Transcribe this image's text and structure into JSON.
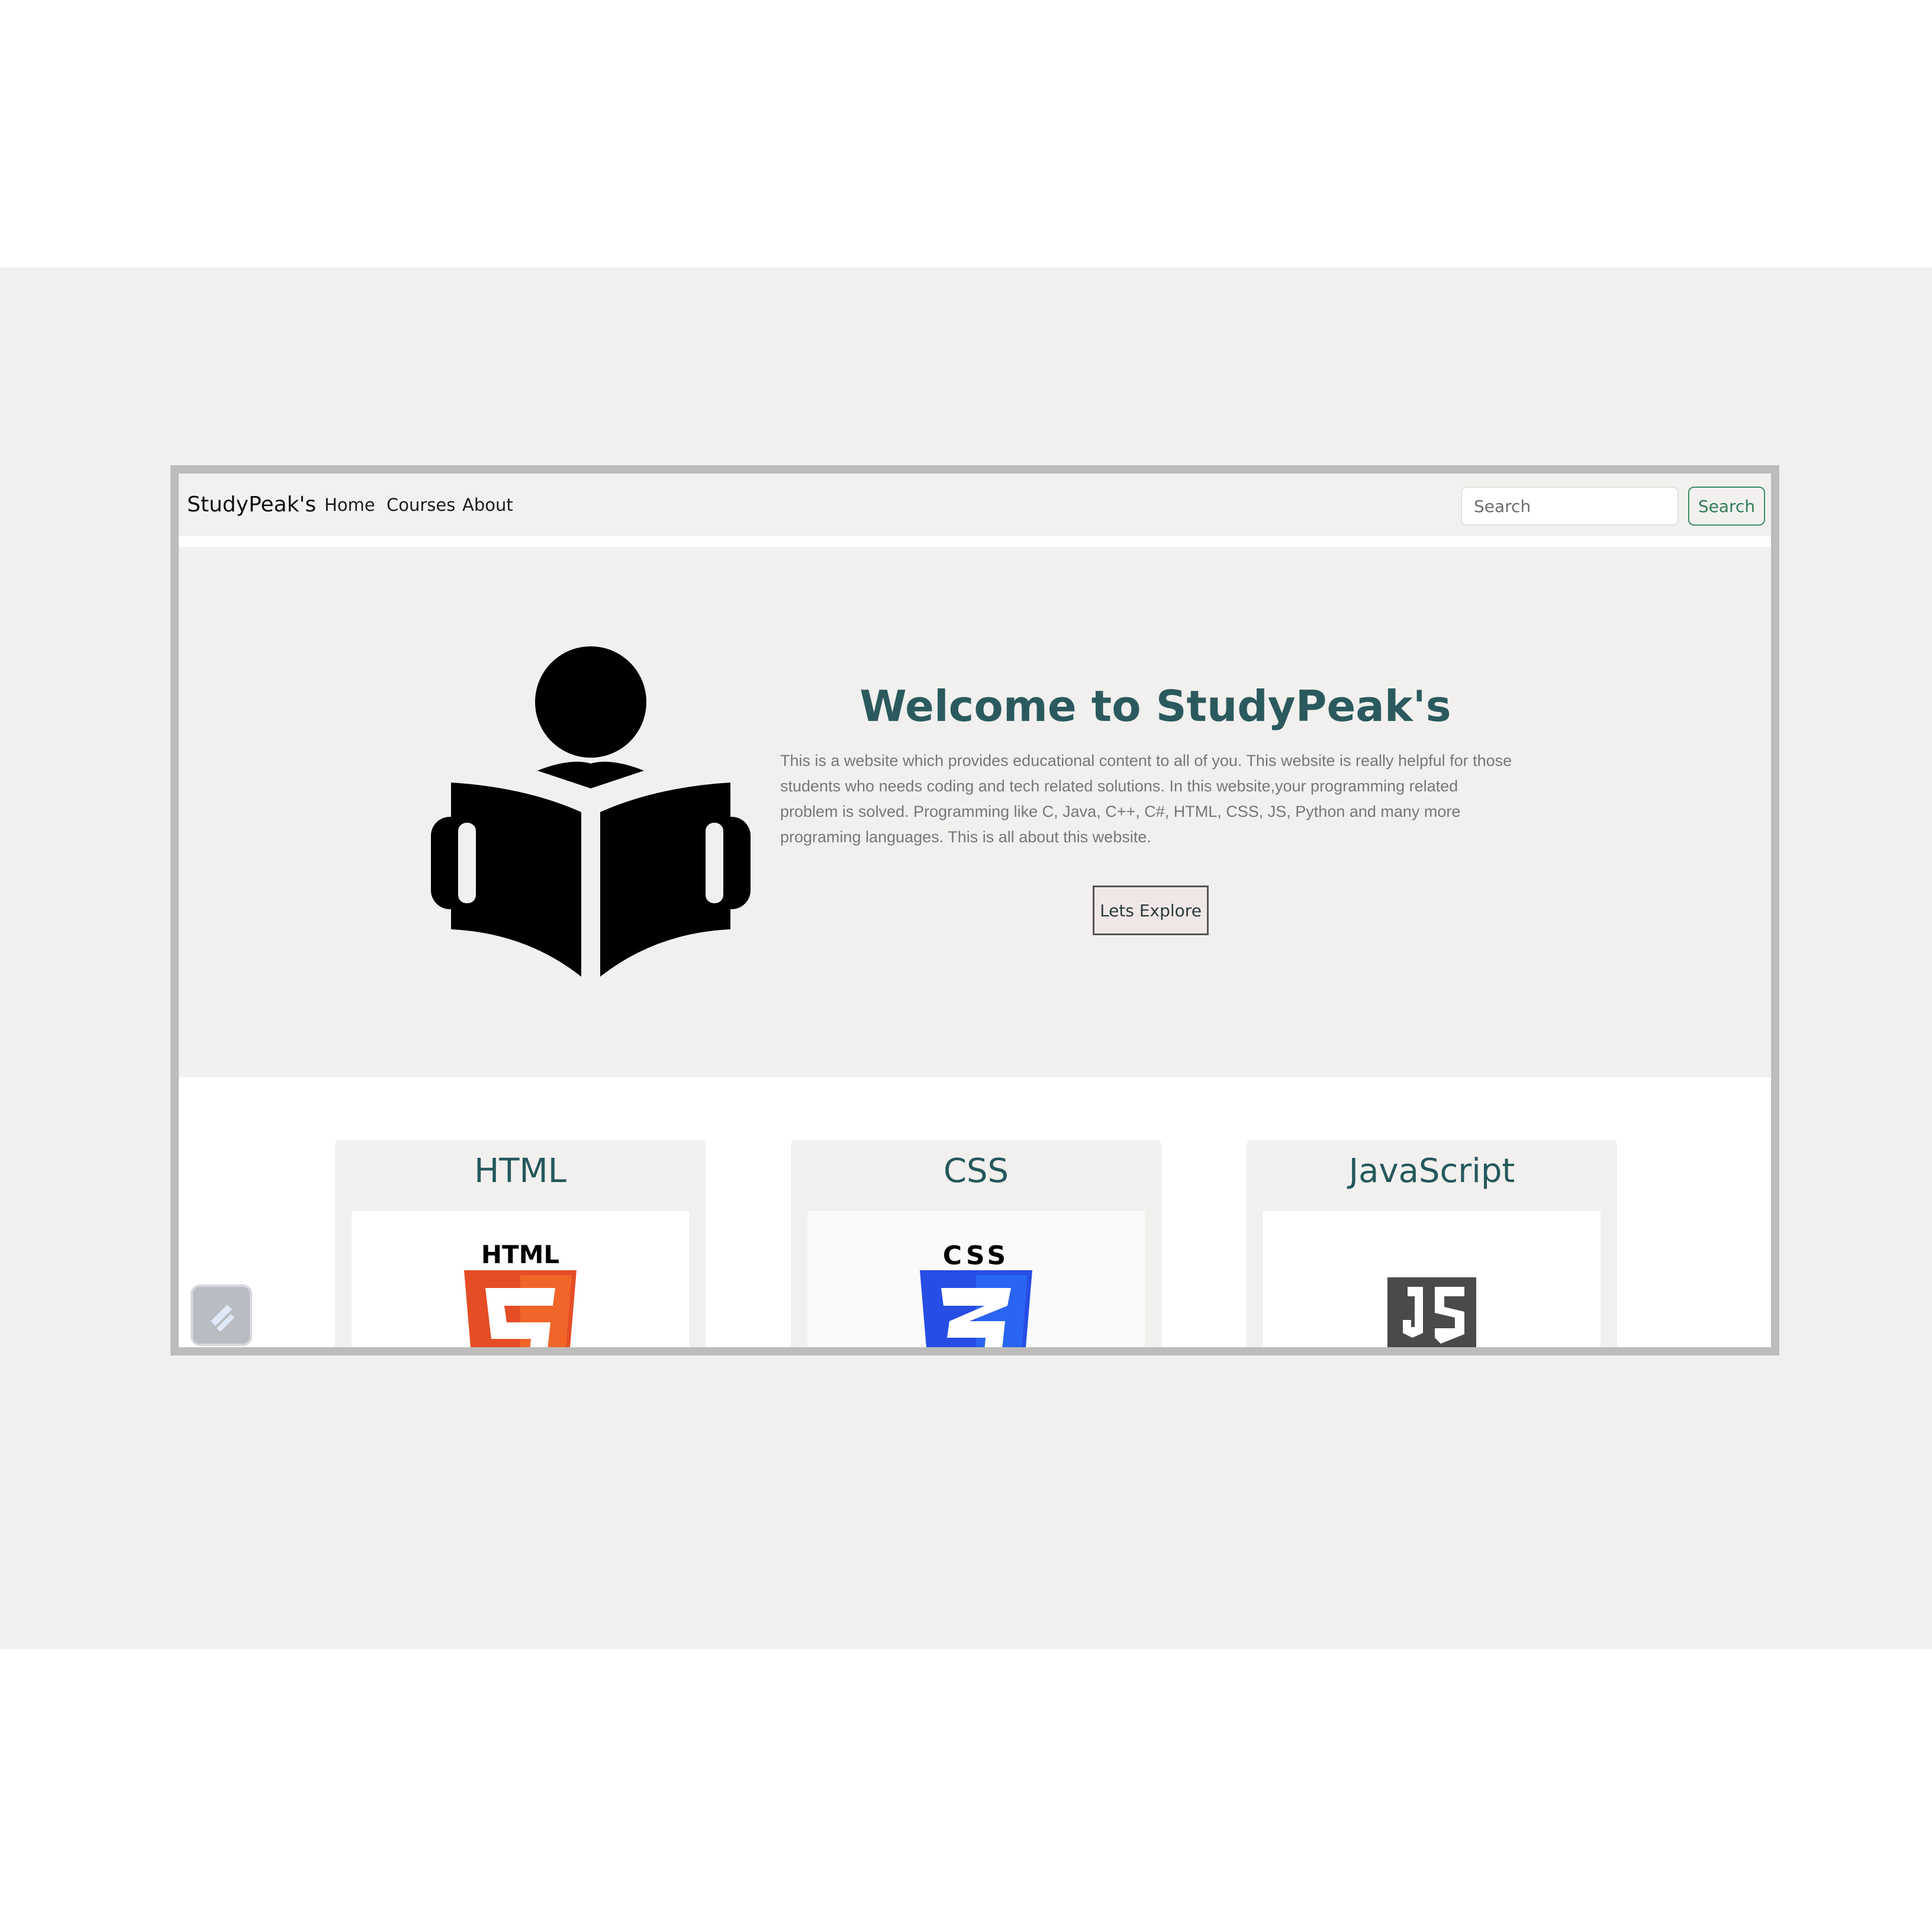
{
  "navbar": {
    "brand": "StudyPeak's",
    "links": [
      "Home",
      "Courses",
      "About"
    ],
    "search_placeholder": "Search",
    "search_button": "Search"
  },
  "hero": {
    "title": "Welcome to StudyPeak's",
    "description": "This is a website which provides educational content to all of you. This website is really helpful for those students who needs coding and tech related solutions. In this website,your programming related problem is solved. Programming like C, Java, C++, C#, HTML, CSS, JS, Python and many more programing languages. This is all about this website.",
    "button": "Lets Explore",
    "icon": "person-reading-book-icon"
  },
  "cards": [
    {
      "title": "HTML",
      "logo": "html5-logo",
      "logo_text": "HTML"
    },
    {
      "title": "CSS",
      "logo": "css3-logo",
      "logo_text": "CSS"
    },
    {
      "title": "JavaScript",
      "logo": "js-logo"
    }
  ],
  "colors": {
    "accent_heading": "#2b5a5e",
    "search_button": "#2e7d56",
    "html_logo": "#e44d26",
    "css_logo": "#264de4",
    "js_logo": "#4a4a4a"
  }
}
